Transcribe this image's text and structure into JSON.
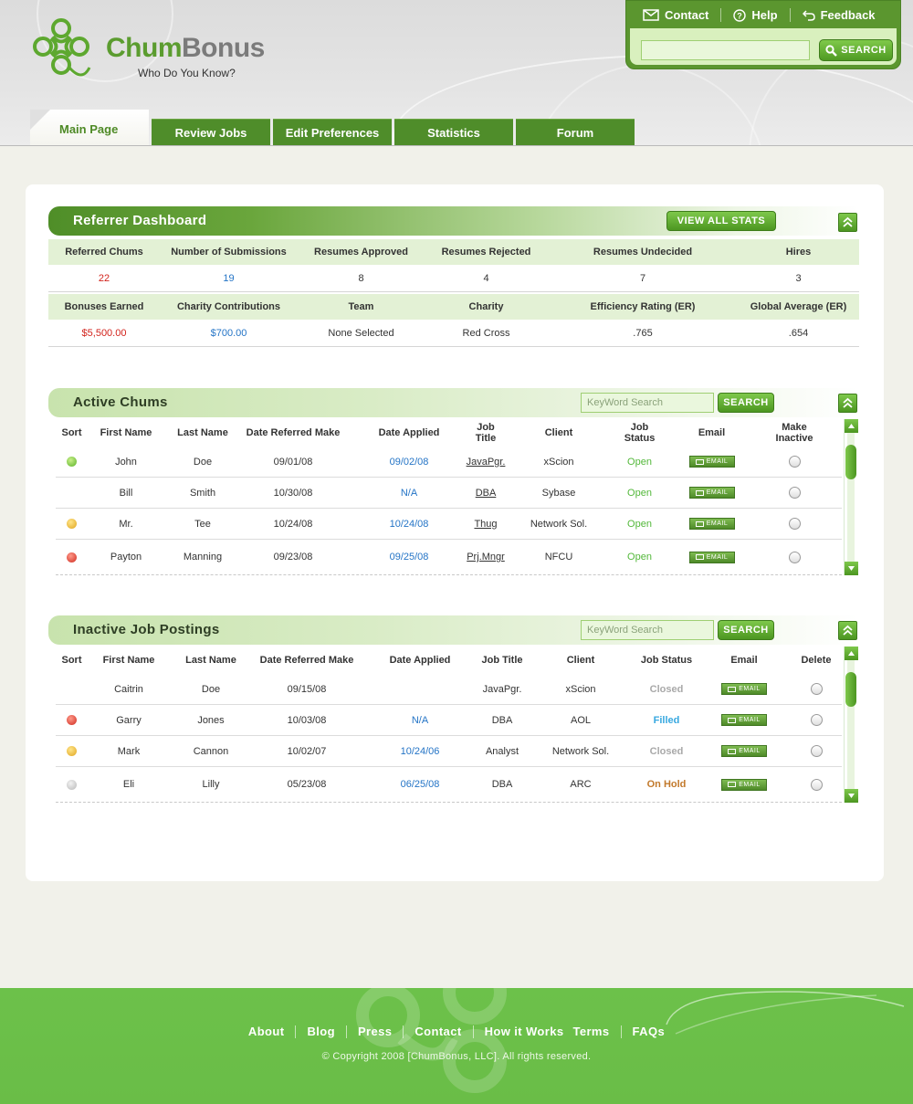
{
  "brand": {
    "name_part1": "Chum",
    "name_part2": "Bonus",
    "tagline": "Who Do You Know?"
  },
  "top_nav": {
    "links": [
      {
        "label": "Contact",
        "icon": "envelope-icon"
      },
      {
        "label": "Help",
        "icon": "question-icon"
      },
      {
        "label": "Feedback",
        "icon": "undo-arrow-icon"
      }
    ],
    "search_value": "",
    "search_button": "SEARCH"
  },
  "tabs": [
    "Main Page",
    "Review Jobs",
    "Edit Preferences",
    "Statistics",
    "Forum"
  ],
  "dashboard": {
    "title": "Referrer Dashboard",
    "view_stats_button": "VIEW ALL STATS",
    "row1_headers": [
      "Referred Chums",
      "Number of Submissions",
      "Resumes Approved",
      "Resumes Rejected",
      "Resumes Undecided",
      "Hires"
    ],
    "row1_values": [
      "22",
      "19",
      "8",
      "4",
      "7",
      "3"
    ],
    "row2_headers": [
      "Bonuses Earned",
      "Charity Contributions",
      "Team",
      "Charity",
      "Efficiency Rating (ER)",
      "Global Average (ER)"
    ],
    "row2_values": [
      "$5,500.00",
      "$700.00",
      "None Selected",
      "Red Cross",
      ".765",
      ".654"
    ],
    "colors": {
      "red_value": "#d2231c",
      "blue_value": "#2474c6"
    }
  },
  "active_chums": {
    "title": "Active Chums",
    "search_placeholder": "KeyWord Search",
    "search_button": "SEARCH",
    "headers": [
      "Sort",
      "First Name",
      "Last Name",
      "Date Referred Make",
      "Date Applied",
      "Job Title",
      "Client",
      "Job Status",
      "Email",
      "Make Inactive"
    ],
    "email_label": "EMAIL",
    "rows": [
      {
        "sort": "green",
        "first": "John",
        "last": "Doe",
        "referred": "09/01/08",
        "applied": "09/02/08",
        "title": "JavaPgr.",
        "client": "xScion",
        "status": "Open"
      },
      {
        "sort": "none",
        "first": "Bill",
        "last": "Smith",
        "referred": "10/30/08",
        "applied": "N/A",
        "title": "DBA",
        "client": "Sybase",
        "status": "Open"
      },
      {
        "sort": "yellow",
        "first": "Mr.",
        "last": "Tee",
        "referred": "10/24/08",
        "applied": "10/24/08",
        "title": "Thug",
        "client": "Network Sol.",
        "status": "Open"
      },
      {
        "sort": "red",
        "first": "Payton",
        "last": "Manning",
        "referred": "09/23/08",
        "applied": "09/25/08",
        "title": "Prj.Mngr",
        "client": "NFCU",
        "status": "Open"
      }
    ]
  },
  "inactive_jobs": {
    "title": "Inactive Job Postings",
    "search_placeholder": "KeyWord Search",
    "search_button": "SEARCH",
    "headers": [
      "Sort",
      "First Name",
      "Last Name",
      "Date Referred Make",
      "Date Applied",
      "Job Title",
      "Client",
      "Job Status",
      "Email",
      "Delete"
    ],
    "email_label": "EMAIL",
    "rows": [
      {
        "sort": "none",
        "first": "Caitrin",
        "last": "Doe",
        "referred": "09/15/08",
        "applied": "",
        "title": "JavaPgr.",
        "client": "xScion",
        "status": "Closed"
      },
      {
        "sort": "red",
        "first": "Garry",
        "last": "Jones",
        "referred": "10/03/08",
        "applied": "N/A",
        "title": "DBA",
        "client": "AOL",
        "status": "Filled"
      },
      {
        "sort": "yellow",
        "first": "Mark",
        "last": "Cannon",
        "referred": "10/02/07",
        "applied": "10/24/06",
        "title": "Analyst",
        "client": "Network Sol.",
        "status": "Closed"
      },
      {
        "sort": "gray",
        "first": "Eli",
        "last": "Lilly",
        "referred": "05/23/08",
        "applied": "06/25/08",
        "title": "DBA",
        "client": "ARC",
        "status": "On Hold"
      }
    ]
  },
  "footer": {
    "links": [
      "About",
      "Blog",
      "Press",
      "Contact",
      "How it Works",
      "Terms",
      "FAQs"
    ],
    "copyright": "© Copyright 2008 [ChumBonus, LLC]. All rights reserved."
  },
  "theme": {
    "primary_green": "#4f8d2a",
    "footer_green": "#6cc14a",
    "light_green": "#e3f1d5"
  }
}
